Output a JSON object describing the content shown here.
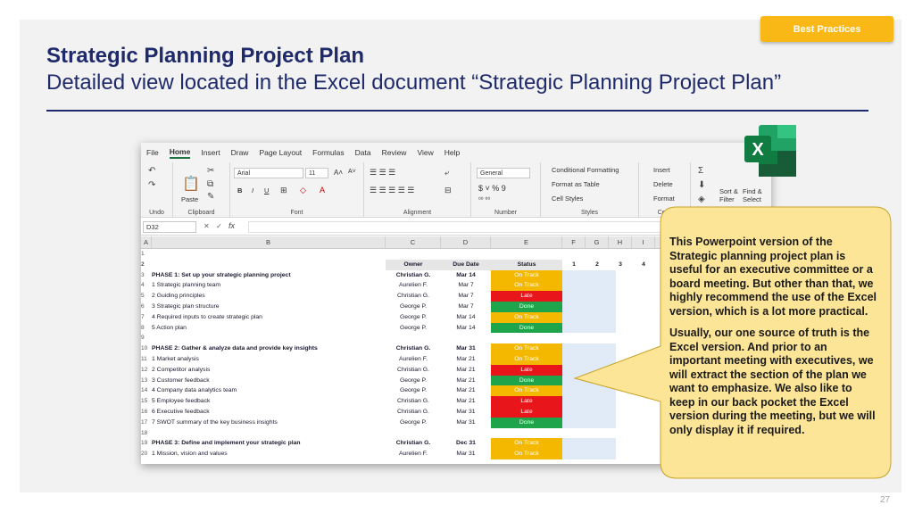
{
  "badge": "Best Practices",
  "title": "Strategic Planning Project Plan",
  "subtitle": "Detailed view located in the Excel document “Strategic Planning Project Plan”",
  "page_number": "27",
  "excel": {
    "menu": [
      "File",
      "Home",
      "Insert",
      "Draw",
      "Page Layout",
      "Formulas",
      "Data",
      "Review",
      "View",
      "Help"
    ],
    "active_menu": "Home",
    "ribbon": {
      "undo_label": "Undo",
      "clipboard_label": "Clipboard",
      "paste_label": "Paste",
      "font_label": "Font",
      "font_name": "Arial",
      "font_size": "11",
      "alignment_label": "Alignment",
      "number_label": "Number",
      "number_format": "General",
      "styles_label": "Styles",
      "conditional_formatting": "Conditional Formatting",
      "format_as_table": "Format as Table",
      "cell_styles": "Cell Styles",
      "insert": "Insert",
      "delete": "Delete",
      "format": "Format",
      "cells_label": "Cells",
      "sort_filter": "Sort &\nFilter",
      "find_select": "Find &\nSelect"
    },
    "name_box": "D32",
    "formula_symbol": "fx",
    "columns": [
      "A",
      "B",
      "C",
      "D",
      "E",
      "F",
      "G",
      "H",
      "I"
    ],
    "header": {
      "owner": "Owner",
      "due": "Due Date",
      "status": "Status",
      "weeks": [
        "1",
        "2",
        "3",
        "4"
      ]
    },
    "row_numbers": [
      "1",
      "2",
      "3",
      "4",
      "5",
      "6",
      "7",
      "8",
      "9",
      "10",
      "11",
      "12",
      "13",
      "14",
      "15",
      "16",
      "17",
      "18",
      "19",
      "20"
    ],
    "rows": [
      {
        "task": "PHASE 1: Set up your strategic planning project",
        "owner": "Christian G.",
        "due": "Mar 14",
        "status": "On Track",
        "phase": true
      },
      {
        "num": "1",
        "task": "Strategic planning team",
        "owner": "Aurelien F.",
        "due": "Mar 7",
        "status": "On Track"
      },
      {
        "num": "2",
        "task": "Guiding principles",
        "owner": "Christian G.",
        "due": "Mar 7",
        "status": "Late"
      },
      {
        "num": "3",
        "task": "Strategic plan structure",
        "owner": "George P.",
        "due": "Mar 7",
        "status": "Done"
      },
      {
        "num": "4",
        "task": "Required inputs to create strategic plan",
        "owner": "George P.",
        "due": "Mar 14",
        "status": "On Track"
      },
      {
        "num": "5",
        "task": "Action plan",
        "owner": "George P.",
        "due": "Mar 14",
        "status": "Done"
      },
      {
        "task": "",
        "owner": "",
        "due": "",
        "status": ""
      },
      {
        "task": "PHASE 2: Gather & analyze data and provide key insights",
        "owner": "Christian G.",
        "due": "Mar 31",
        "status": "On Track",
        "phase": true
      },
      {
        "num": "1",
        "task": "Market analysis",
        "owner": "Aurelien F.",
        "due": "Mar 21",
        "status": "On Track"
      },
      {
        "num": "2",
        "task": "Competitor analysis",
        "owner": "Christian G.",
        "due": "Mar 21",
        "status": "Late"
      },
      {
        "num": "3",
        "task": "Customer feedback",
        "owner": "George P.",
        "due": "Mar 21",
        "status": "Done"
      },
      {
        "num": "4",
        "task": "Company data analytics team",
        "owner": "George P.",
        "due": "Mar 21",
        "status": "On Track"
      },
      {
        "num": "5",
        "task": "Employee feedback",
        "owner": "Christian G.",
        "due": "Mar 21",
        "status": "Late"
      },
      {
        "num": "6",
        "task": "Executive feedback",
        "owner": "Christian G.",
        "due": "Mar 31",
        "status": "Late"
      },
      {
        "num": "7",
        "task": "SWOT summary of the key business insights",
        "owner": "George P.",
        "due": "Mar 31",
        "status": "Done"
      },
      {
        "task": "",
        "owner": "",
        "due": "",
        "status": ""
      },
      {
        "task": "PHASE 3: Define and implement your strategic plan",
        "owner": "Christian G.",
        "due": "Dec 31",
        "status": "On Track",
        "phase": true
      },
      {
        "num": "1",
        "task": "Mission, vision and values",
        "owner": "Aurelien F.",
        "due": "Mar 31",
        "status": "On Track"
      }
    ],
    "status_colors": {
      "On Track": "#f5b800",
      "Late": "#e8161b",
      "Done": "#1ea44a"
    }
  },
  "callout": {
    "p1": "This Powerpoint version of the Strategic planning project plan is useful for an executive committee or a board meeting. But other than that, we highly recommend the use of the Excel version, which is a lot more practical.",
    "p2": "Usually, our one source of truth is the Excel version. And prior to an important meeting with executives, we will extract the section of the plan we want to emphasize. We also like to keep in our back pocket the Excel version during the meeting, but we will only display it if required."
  }
}
